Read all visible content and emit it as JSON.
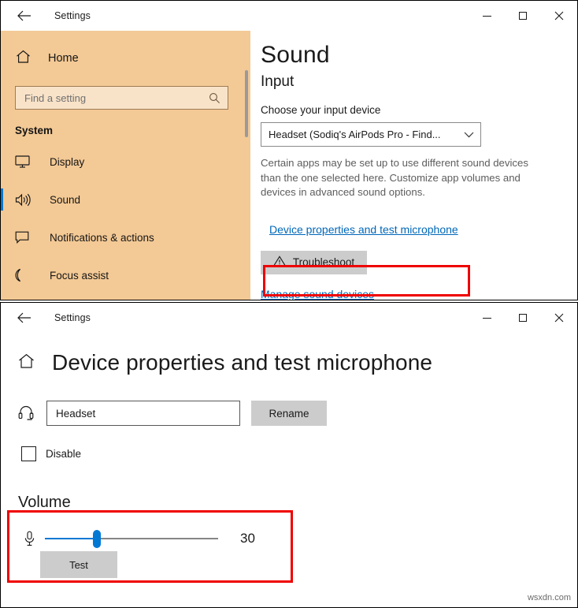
{
  "top_window": {
    "titlebar": {
      "back_icon": "back-arrow-icon",
      "title": "Settings",
      "minimize_icon": "minimize-icon",
      "maximize_icon": "maximize-icon",
      "close_icon": "close-icon"
    },
    "sidebar": {
      "home_icon": "home-icon",
      "home_label": "Home",
      "search_placeholder": "Find a setting",
      "search_value": "",
      "search_icon": "search-icon",
      "section_label": "System",
      "background_color": "#f3c995",
      "accent_color": "#0078d4",
      "items": [
        {
          "label": "Display",
          "icon": "monitor-icon",
          "selected": false
        },
        {
          "label": "Sound",
          "icon": "speaker-icon",
          "selected": true
        },
        {
          "label": "Notifications & actions",
          "icon": "notification-icon",
          "selected": false
        },
        {
          "label": "Focus assist",
          "icon": "moon-icon",
          "selected": false
        }
      ]
    },
    "main": {
      "title": "Sound",
      "section_heading": "Input",
      "device_label": "Choose your input device",
      "device_value": "Headset (Sodiq's AirPods Pro - Find...",
      "device_chevron_icon": "chevron-down-icon",
      "description": "Certain apps may be set up to use different sound devices than the one selected here. Customize app volumes and devices in advanced sound options.",
      "device_properties_link": "Device properties and test microphone",
      "troubleshoot_label": "Troubleshoot",
      "troubleshoot_icon": "warning-triangle-icon",
      "manage_sound_devices_link": "Manage sound devices",
      "link_color": "#0067b8",
      "highlight_color": "#ef0000"
    }
  },
  "bottom_window": {
    "titlebar": {
      "back_icon": "back-arrow-icon",
      "title": "Settings",
      "minimize_icon": "minimize-icon",
      "maximize_icon": "maximize-icon",
      "close_icon": "close-icon"
    },
    "main": {
      "home_icon": "home-icon",
      "page_title": "Device properties and test microphone",
      "device_name_icon": "headset-icon",
      "device_name_value": "Headset",
      "device_name_placeholder": "Headset",
      "rename_label": "Rename",
      "disable_label": "Disable",
      "disable_checked": false,
      "volume_heading": "Volume",
      "volume_icon": "microphone-icon",
      "volume_value": "30",
      "volume_percent": 30,
      "test_label": "Test",
      "highlight_color": "#ef0000",
      "accent_color": "#0078d4"
    }
  },
  "watermark": "wsxdn.com"
}
